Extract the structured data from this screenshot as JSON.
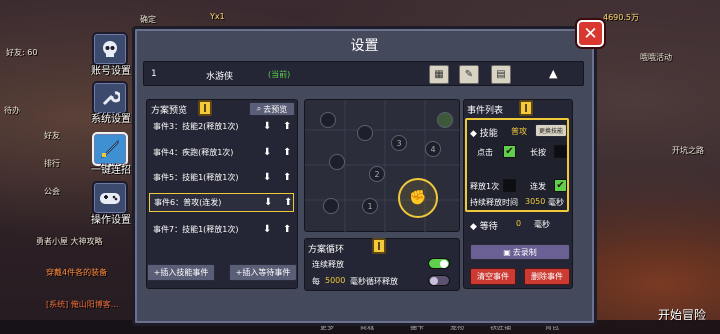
{
  "background": {
    "left_texts": [
      "好友: 60",
      "待办",
      "好友",
      "排行",
      "公会",
      "勇者小屋 大神攻略",
      "穿戴4件各的装备",
      "[系统] 俺山阳博客..."
    ],
    "top_texts": [
      "4690.5万",
      "确定",
      "Yx1"
    ],
    "right_texts": [
      "开始冒险",
      "开坑之路",
      "哦哦活动"
    ],
    "bottom_items": [
      "更多",
      "商城",
      "猫卡",
      "宠物",
      "铁匠铺",
      "背包"
    ]
  },
  "sidebar": {
    "items": [
      {
        "label": "账号设置",
        "icon": "skull-icon"
      },
      {
        "label": "系统设置",
        "icon": "wrench-icon"
      },
      {
        "label": "一键连招",
        "icon": "sword-icon"
      },
      {
        "label": "操作设置",
        "icon": "controller-icon"
      }
    ]
  },
  "panel": {
    "title": "设置"
  },
  "plan": {
    "index": "1",
    "name": "水游侠",
    "status": "(当前)"
  },
  "preview": {
    "title": "方案预览",
    "goto_label": "去预览",
    "events": [
      "事件3：技能2(释放1次)",
      "事件4：疾跑(释放1次)",
      "事件5：技能1(释放1次)",
      "事件6：普攻(连发)",
      "事件7：技能1(释放1次)"
    ],
    "insert_skill": "+插入技能事件",
    "insert_wait": "+插入等待事件"
  },
  "map_nodes": [
    "1",
    "2",
    "3",
    "4"
  ],
  "loop": {
    "title": "方案循环",
    "continuous": "连续释放",
    "every": "每",
    "interval": "5000",
    "unit": "毫秒循环释放"
  },
  "event_list": {
    "title": "事件列表",
    "skill_label": "技能",
    "skill_value": "普攻",
    "change_skill": "更换技能",
    "tap": "点击",
    "long_press": "长按",
    "release_once": "释放1次",
    "burst": "连发",
    "duration_label": "持续释放时间",
    "duration_value": "3050",
    "duration_unit": "毫秒",
    "wait_label": "等待",
    "wait_value": "0",
    "wait_unit": "毫秒",
    "record": "去录制",
    "clear": "清空事件",
    "delete": "删除事件"
  },
  "colors": {
    "accent": "#f0c93a",
    "checkbox_on": "#5fd04c",
    "danger": "#cc3b33",
    "status": "#5fd04c"
  }
}
